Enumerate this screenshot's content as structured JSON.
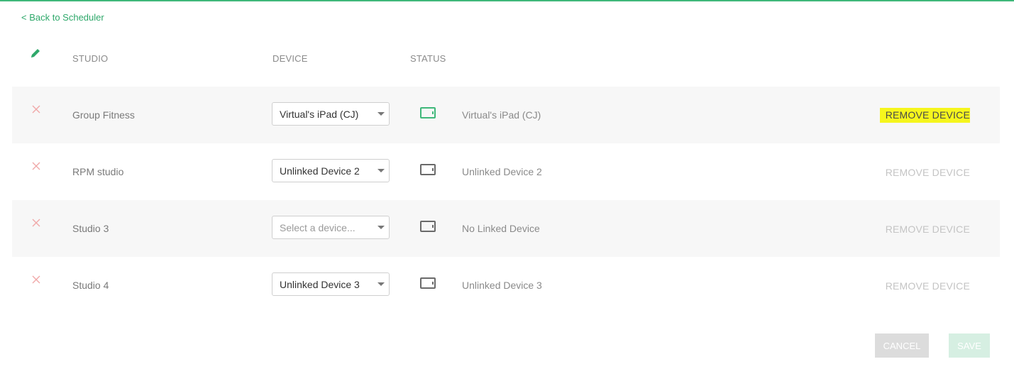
{
  "nav": {
    "back_label": "< Back to Scheduler"
  },
  "table": {
    "headers": {
      "edit_icon": "pencil-icon",
      "studio": "STUDIO",
      "device": "DEVICE",
      "status": "STATUS"
    },
    "rows": [
      {
        "studio": "Group Fitness",
        "device": "Virtual's iPad (CJ)",
        "device_placeholder": false,
        "status_text": "Virtual's iPad (CJ)",
        "status_linked": true,
        "remove_label": "REMOVE DEVICE",
        "remove_highlighted": true
      },
      {
        "studio": "RPM studio",
        "device": "Unlinked Device 2",
        "device_placeholder": false,
        "status_text": "Unlinked Device 2",
        "status_linked": false,
        "remove_label": "REMOVE DEVICE",
        "remove_highlighted": false
      },
      {
        "studio": "Studio 3",
        "device": "Select a device...",
        "device_placeholder": true,
        "status_text": "No Linked Device",
        "status_linked": false,
        "remove_label": "REMOVE DEVICE",
        "remove_highlighted": false
      },
      {
        "studio": "Studio 4",
        "device": "Unlinked Device 3",
        "device_placeholder": false,
        "status_text": "Unlinked Device 3",
        "status_linked": false,
        "remove_label": "REMOVE DEVICE",
        "remove_highlighted": false
      }
    ]
  },
  "actions": {
    "cancel_label": "CANCEL",
    "save_label": "SAVE"
  },
  "colors": {
    "accent": "#2ea86a",
    "status_linked": "#3fb87a",
    "status_unlinked": "#6a6a6a",
    "delete_icon": "#f0a8a8",
    "highlight": "#f6f61d"
  },
  "icons": {
    "delete": "close-icon",
    "status": "tablet-icon",
    "dropdown": "chevron-down-icon"
  }
}
